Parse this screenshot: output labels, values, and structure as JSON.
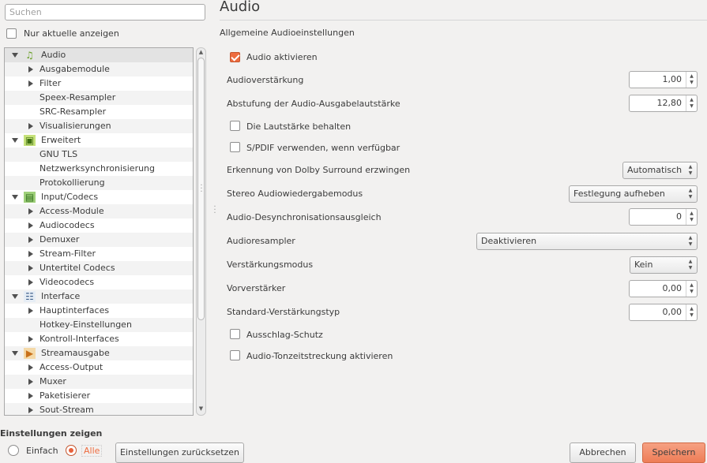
{
  "sidebar": {
    "search_placeholder": "Suchen",
    "only_current_label": "Nur aktuelle anzeigen",
    "tree": [
      {
        "label": "Audio",
        "level": 0,
        "expanded": true,
        "icon": "music-note-icon",
        "selected": true
      },
      {
        "label": "Ausgabemodule",
        "level": 1,
        "expandable": true
      },
      {
        "label": "Filter",
        "level": 1,
        "expandable": true
      },
      {
        "label": "Speex-Resampler",
        "level": 1
      },
      {
        "label": "SRC-Resampler",
        "level": 1
      },
      {
        "label": "Visualisierungen",
        "level": 1,
        "expandable": true
      },
      {
        "label": "Erweitert",
        "level": 0,
        "expanded": true,
        "icon": "chip-icon"
      },
      {
        "label": "GNU TLS",
        "level": 1
      },
      {
        "label": "Netzwerksynchronisierung",
        "level": 1
      },
      {
        "label": "Protokollierung",
        "level": 1
      },
      {
        "label": "Input/Codecs",
        "level": 0,
        "expanded": true,
        "icon": "codec-icon"
      },
      {
        "label": "Access-Module",
        "level": 1,
        "expandable": true
      },
      {
        "label": "Audiocodecs",
        "level": 1,
        "expandable": true
      },
      {
        "label": "Demuxer",
        "level": 1,
        "expandable": true
      },
      {
        "label": "Stream-Filter",
        "level": 1,
        "expandable": true
      },
      {
        "label": "Untertitel Codecs",
        "level": 1,
        "expandable": true
      },
      {
        "label": "Videocodecs",
        "level": 1,
        "expandable": true
      },
      {
        "label": "Interface",
        "level": 0,
        "expanded": true,
        "icon": "interface-icon"
      },
      {
        "label": "Hauptinterfaces",
        "level": 1,
        "expandable": true
      },
      {
        "label": "Hotkey-Einstellungen",
        "level": 1
      },
      {
        "label": "Kontroll-Interfaces",
        "level": 1,
        "expandable": true
      },
      {
        "label": "Streamausgabe",
        "level": 0,
        "expanded": true,
        "icon": "stream-output-icon"
      },
      {
        "label": "Access-Output",
        "level": 1,
        "expandable": true
      },
      {
        "label": "Muxer",
        "level": 1,
        "expandable": true
      },
      {
        "label": "Paketisierer",
        "level": 1,
        "expandable": true
      },
      {
        "label": "Sout-Stream",
        "level": 1,
        "expandable": true
      }
    ]
  },
  "main": {
    "title": "Audio",
    "section": "Allgemeine Audioeinstellungen",
    "enable_audio": {
      "label": "Audio aktivieren",
      "checked": true
    },
    "gain": {
      "label": "Audioverstärkung",
      "value": "1,00"
    },
    "volume_step": {
      "label": "Abstufung der Audio-Ausgabelautstärke",
      "value": "12,80"
    },
    "keep_volume": {
      "label": "Die Lautstärke behalten",
      "checked": false
    },
    "spdif": {
      "label": "S/PDIF verwenden, wenn verfügbar",
      "checked": false
    },
    "dolby": {
      "label": "Erkennung von Dolby Surround erzwingen",
      "value": "Automatisch"
    },
    "stereo_mode": {
      "label": "Stereo Audiowiedergabemodus",
      "value": "Festlegung aufheben"
    },
    "desync": {
      "label": "Audio-Desynchronisationsausgleich",
      "value": "0"
    },
    "resampler": {
      "label": "Audioresampler",
      "value": "Deaktivieren"
    },
    "replay_gain_mode": {
      "label": "Verstärkungsmodus",
      "value": "Kein"
    },
    "preamp": {
      "label": "Vorverstärker",
      "value": "0,00"
    },
    "default_gain": {
      "label": "Standard-Verstärkungstyp",
      "value": "0,00"
    },
    "peak_protection": {
      "label": "Ausschlag-Schutz",
      "checked": false
    },
    "time_stretch": {
      "label": "Audio-Tonzeitstreckung aktivieren",
      "checked": false
    }
  },
  "footer": {
    "show_settings_label": "Einstellungen zeigen",
    "simple_label": "Einfach",
    "all_label": "Alle",
    "mode_selected": "Alle",
    "reset_label": "Einstellungen zurücksetzen",
    "cancel_label": "Abbrechen",
    "save_label": "Speichern"
  },
  "colors": {
    "accent": "#ee6c3f"
  }
}
